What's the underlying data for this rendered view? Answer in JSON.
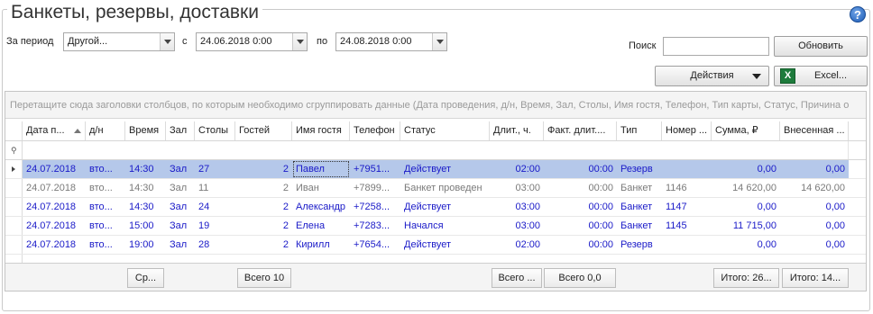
{
  "page": {
    "title": "Банкеты, резервы, доставки"
  },
  "filters": {
    "period_label": "За период",
    "period_value": "Другой...",
    "from_label": "с",
    "from_value": "24.06.2018 0:00",
    "to_label": "по",
    "to_value": "24.08.2018 0:00",
    "search_label": "Поиск",
    "search_value": ""
  },
  "toolbar": {
    "refresh_label": "Обновить",
    "actions_label": "Действия",
    "excel_label": "Excel..."
  },
  "grid": {
    "group_hint": "Перетащите сюда заголовки столбцов, по которым необходимо сгруппировать данные (Дата проведения, д/н, Время, Зал, Столы, Имя гостя, Телефон, Тип карты, Статус, Причина о",
    "columns": [
      "Дата п...",
      "д/н",
      "Время",
      "Зал",
      "Столы",
      "Гостей",
      "Имя гостя",
      "Телефон",
      "Статус",
      "Длит., ч.",
      "Факт. длит....",
      "Тип",
      "Номер ...",
      "Сумма, ₽",
      "Внесенная ..."
    ],
    "rows": [
      {
        "date": "24.07.2018",
        "dow": "вто...",
        "time": "14:30",
        "hall": "Зал",
        "tables": "27",
        "guests": "2",
        "name": "Павел",
        "phone": "+7951...",
        "status": "Действует",
        "dur": "02:00",
        "fact": "00:00",
        "type": "Резерв",
        "num": "",
        "sum": "0,00",
        "paid": "0,00"
      },
      {
        "date": "24.07.2018",
        "dow": "вто...",
        "time": "14:30",
        "hall": "Зал",
        "tables": "11",
        "guests": "2",
        "name": "Иван",
        "phone": "+7899...",
        "status": "Банкет проведен",
        "dur": "03:00",
        "fact": "00:00",
        "type": "Банкет",
        "num": "1146",
        "sum": "14 620,00",
        "paid": "14 620,00"
      },
      {
        "date": "24.07.2018",
        "dow": "вто...",
        "time": "14:30",
        "hall": "Зал",
        "tables": "24",
        "guests": "2",
        "name": "Александр",
        "phone": "+7258...",
        "status": "Действует",
        "dur": "03:00",
        "fact": "00:00",
        "type": "Банкет",
        "num": "1147",
        "sum": "0,00",
        "paid": "0,00"
      },
      {
        "date": "24.07.2018",
        "dow": "вто...",
        "time": "15:00",
        "hall": "Зал",
        "tables": "19",
        "guests": "2",
        "name": "Елена",
        "phone": "+7283...",
        "status": "Начался",
        "dur": "03:00",
        "fact": "00:00",
        "type": "Банкет",
        "num": "1145",
        "sum": "11 715,00",
        "paid": "0,00"
      },
      {
        "date": "24.07.2018",
        "dow": "вто...",
        "time": "19:00",
        "hall": "Зал",
        "tables": "28",
        "guests": "2",
        "name": "Кирилл",
        "phone": "+7654...",
        "status": "Действует",
        "dur": "02:00",
        "fact": "00:00",
        "type": "Резерв",
        "num": "",
        "sum": "0,00",
        "paid": "0,00"
      }
    ],
    "footer": {
      "time_summary": "Ср...",
      "tables_summary": "Всего 10",
      "status_summary": "Всего ...",
      "dur_summary": "Всего 0,0",
      "sum_summary": "Итого: 26...",
      "paid_summary": "Итого: 14..."
    }
  }
}
